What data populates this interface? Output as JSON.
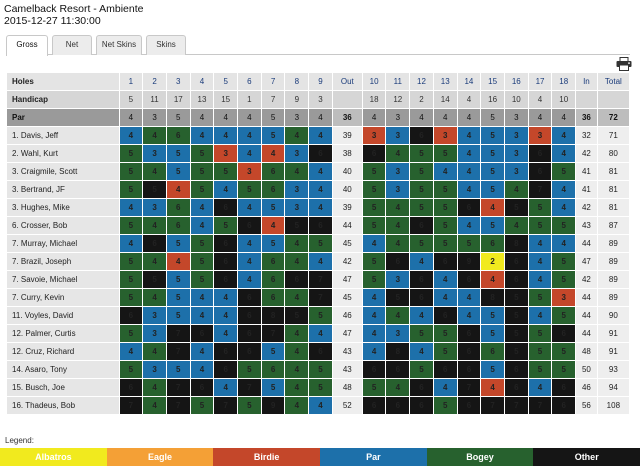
{
  "header": {
    "title": "Camelback Resort - Ambiente",
    "datetime": "2015-12-27 11:30:00"
  },
  "tabs": [
    {
      "label": "Gross",
      "active": true
    },
    {
      "label": "Net",
      "active": false
    },
    {
      "label": "Net Skins",
      "active": false
    },
    {
      "label": "Skins",
      "active": false
    }
  ],
  "table": {
    "holes_label": "Holes",
    "handicap_label": "Handicap",
    "par_label": "Par",
    "holes": [
      "1",
      "2",
      "3",
      "4",
      "5",
      "6",
      "7",
      "8",
      "9",
      "Out",
      "10",
      "11",
      "12",
      "13",
      "14",
      "15",
      "16",
      "17",
      "18",
      "In",
      "Total"
    ],
    "handicap": [
      "5",
      "11",
      "17",
      "13",
      "15",
      "1",
      "7",
      "9",
      "3",
      "",
      "18",
      "12",
      "2",
      "14",
      "4",
      "16",
      "10",
      "4",
      "10",
      "",
      ""
    ],
    "par": [
      "4",
      "3",
      "5",
      "4",
      "4",
      "4",
      "5",
      "3",
      "4",
      "36",
      "4",
      "3",
      "4",
      "4",
      "4",
      "5",
      "3",
      "4",
      "4",
      "36",
      "72"
    ],
    "players": [
      {
        "name": "1. Davis, Jeff",
        "scores": [
          "4",
          "4",
          "6",
          "4",
          "4",
          "4",
          "5",
          "4",
          "4"
        ],
        "out": "39",
        "back": [
          "3",
          "3",
          "6",
          "3",
          "4",
          "5",
          "3",
          "3",
          "4"
        ],
        "in": "32",
        "total": "71"
      },
      {
        "name": "2. Wahl, Kurt",
        "scores": [
          "5",
          "3",
          "5",
          "5",
          "3",
          "4",
          "4",
          "3",
          "6"
        ],
        "out": "38",
        "back": [
          "6",
          "4",
          "5",
          "5",
          "4",
          "5",
          "3",
          "6",
          "4"
        ],
        "in": "42",
        "total": "80"
      },
      {
        "name": "3. Craigmile, Scott",
        "scores": [
          "5",
          "4",
          "5",
          "5",
          "5",
          "3",
          "6",
          "4",
          "4"
        ],
        "out": "40",
        "back": [
          "5",
          "3",
          "5",
          "4",
          "4",
          "5",
          "3",
          "6",
          "5"
        ],
        "in": "41",
        "total": "81"
      },
      {
        "name": "3. Bertrand, JF",
        "scores": [
          "5",
          "5",
          "4",
          "5",
          "4",
          "5",
          "6",
          "3",
          "4"
        ],
        "out": "40",
        "back": [
          "5",
          "3",
          "5",
          "5",
          "4",
          "5",
          "4",
          "7",
          "4"
        ],
        "in": "41",
        "total": "81"
      },
      {
        "name": "3. Hughes, Mike",
        "scores": [
          "4",
          "3",
          "6",
          "4",
          "6",
          "4",
          "5",
          "3",
          "4"
        ],
        "out": "39",
        "back": [
          "5",
          "4",
          "5",
          "5",
          "6",
          "4",
          "5",
          "5",
          "4"
        ],
        "in": "42",
        "total": "81"
      },
      {
        "name": "6. Crosser, Bob",
        "scores": [
          "5",
          "4",
          "6",
          "4",
          "5",
          "6",
          "4",
          "5",
          "6"
        ],
        "out": "44",
        "back": [
          "5",
          "4",
          "6",
          "5",
          "4",
          "5",
          "4",
          "5",
          "5"
        ],
        "in": "43",
        "total": "87"
      },
      {
        "name": "7. Murray, Michael",
        "scores": [
          "4",
          "6",
          "5",
          "5",
          "6",
          "4",
          "5",
          "4",
          "5"
        ],
        "out": "45",
        "back": [
          "4",
          "4",
          "5",
          "5",
          "5",
          "6",
          "8",
          "4",
          "4"
        ],
        "in": "44",
        "total": "89"
      },
      {
        "name": "7. Brazil, Joseph",
        "scores": [
          "5",
          "4",
          "4",
          "5",
          "6",
          "4",
          "6",
          "4",
          "4"
        ],
        "out": "42",
        "back": [
          "5",
          "6",
          "4",
          "6",
          "9",
          "2",
          "6",
          "4",
          "5"
        ],
        "in": "47",
        "total": "89"
      },
      {
        "name": "7. Savoie, Michael",
        "scores": [
          "5",
          "5",
          "5",
          "5",
          "6",
          "4",
          "6",
          "6",
          "7"
        ],
        "out": "47",
        "back": [
          "5",
          "3",
          "6",
          "4",
          "6",
          "4",
          "6",
          "4",
          "5"
        ],
        "in": "42",
        "total": "89"
      },
      {
        "name": "7. Curry, Kevin",
        "scores": [
          "5",
          "4",
          "5",
          "4",
          "4",
          "6",
          "6",
          "4",
          "7"
        ],
        "out": "45",
        "back": [
          "4",
          "5",
          "6",
          "4",
          "4",
          "8",
          "5",
          "5",
          "3"
        ],
        "in": "44",
        "total": "89"
      },
      {
        "name": "11. Voyles, David",
        "scores": [
          "6",
          "3",
          "5",
          "4",
          "4",
          "6",
          "8",
          "5",
          "5"
        ],
        "out": "46",
        "back": [
          "4",
          "4",
          "4",
          "6",
          "4",
          "5",
          "5",
          "4",
          "5"
        ],
        "in": "44",
        "total": "90"
      },
      {
        "name": "12. Palmer, Curtis",
        "scores": [
          "5",
          "3",
          "7",
          "6",
          "4",
          "6",
          "7",
          "4",
          "4"
        ],
        "out": "47",
        "back": [
          "4",
          "3",
          "5",
          "5",
          "6",
          "5",
          "5",
          "5",
          "6"
        ],
        "in": "44",
        "total": "91"
      },
      {
        "name": "12. Cruz, Richard",
        "scores": [
          "4",
          "4",
          "7",
          "4",
          "6",
          "6",
          "5",
          "4",
          "6"
        ],
        "out": "43",
        "back": [
          "4",
          "8",
          "4",
          "5",
          "6",
          "6",
          "5",
          "5",
          "5"
        ],
        "in": "48",
        "total": "91"
      },
      {
        "name": "14. Asaro, Tony",
        "scores": [
          "5",
          "3",
          "5",
          "4",
          "6",
          "5",
          "6",
          "4",
          "5"
        ],
        "out": "43",
        "back": [
          "6",
          "6",
          "5",
          "6",
          "6",
          "5",
          "6",
          "5",
          "5"
        ],
        "in": "50",
        "total": "93"
      },
      {
        "name": "15. Busch, Joe",
        "scores": [
          "6",
          "4",
          "7",
          "6",
          "4",
          "7",
          "5",
          "4",
          "5"
        ],
        "out": "48",
        "back": [
          "5",
          "4",
          "6",
          "4",
          "7",
          "4",
          "6",
          "4",
          "6"
        ],
        "in": "46",
        "total": "94"
      },
      {
        "name": "16. Thadeus, Bob",
        "scores": [
          "7",
          "4",
          "7",
          "5",
          "7",
          "5",
          "9",
          "4",
          "4"
        ],
        "out": "52",
        "back": [
          "6",
          "6",
          "6",
          "5",
          "6",
          "7",
          "7",
          "7",
          "6"
        ],
        "in": "56",
        "total": "108"
      }
    ]
  },
  "legend": {
    "label": "Legend:",
    "items": [
      {
        "label": "Albatros",
        "color": "#f1ea1e",
        "text_color": "#ffffff"
      },
      {
        "label": "Eagle",
        "color": "#f4a036",
        "text_color": "#ffffff"
      },
      {
        "label": "Birdie",
        "color": "#c4472a",
        "text_color": "#ffffff"
      },
      {
        "label": "Par",
        "color": "#1d70aa",
        "text_color": "#ffffff"
      },
      {
        "label": "Bogey",
        "color": "#27612e",
        "text_color": "#ffffff"
      },
      {
        "label": "Other",
        "color": "#151515",
        "text_color": "#ffffff"
      }
    ]
  },
  "icons": {
    "print": "printer-icon"
  }
}
